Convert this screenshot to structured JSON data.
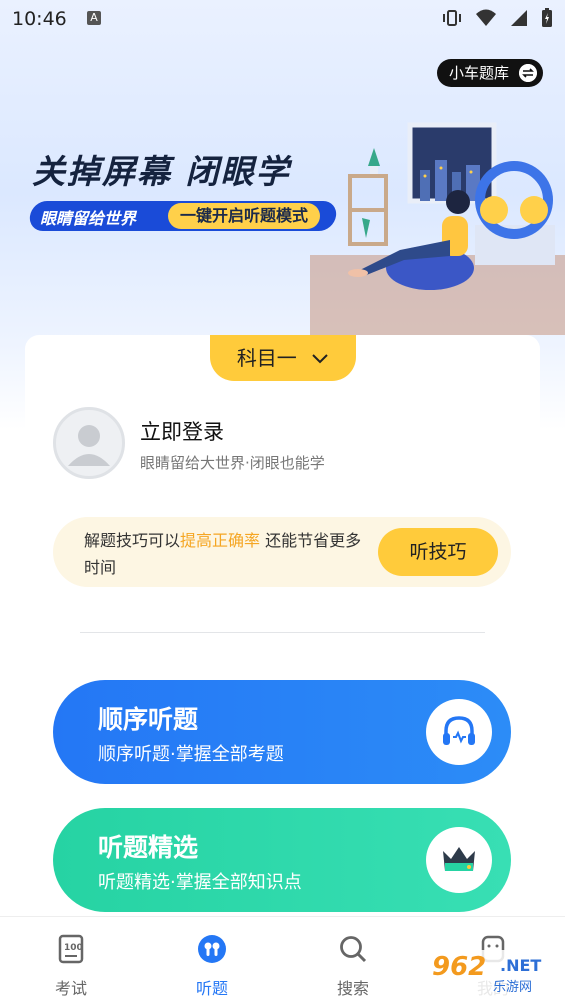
{
  "status_bar": {
    "time": "10:46",
    "indicator": "A",
    "icons": [
      "vibrate-icon",
      "wifi-icon",
      "signal-icon",
      "battery-icon"
    ]
  },
  "header": {
    "quiz_bank_label": "小车题库"
  },
  "banner": {
    "title": "关掉屏幕 闭眼学",
    "pill_left": "眼睛留给世界",
    "pill_right": "一键开启听题模式"
  },
  "subject": {
    "selected": "科目一"
  },
  "login": {
    "title": "立即登录",
    "subtitle": "眼睛留给大世界·闭眼也能学"
  },
  "tip": {
    "text_before": "解题技巧可以",
    "highlight": "提高正确率",
    "text_after": " 还能节省更多时间",
    "button": "听技巧"
  },
  "modes": [
    {
      "title": "顺序听题",
      "subtitle": "顺序听题·掌握全部考题",
      "icon": "headphones-icon"
    },
    {
      "title": "听题精选",
      "subtitle": "听题精选·掌握全部知识点",
      "icon": "crown-icon"
    }
  ],
  "bottom_nav": [
    {
      "label": "考试",
      "icon": "exam-icon",
      "active": false
    },
    {
      "label": "听题",
      "icon": "earbuds-icon",
      "active": true
    },
    {
      "label": "搜索",
      "icon": "search-icon",
      "active": false
    },
    {
      "label": "我的",
      "icon": "profile-icon",
      "active": false
    }
  ],
  "watermark": {
    "number": "962",
    "net": ".NET",
    "sub": "乐游网"
  },
  "colors": {
    "accent_blue": "#2477f5",
    "accent_green": "#26d3a3",
    "accent_yellow": "#ffcb3b",
    "highlight_orange": "#f5a623"
  }
}
